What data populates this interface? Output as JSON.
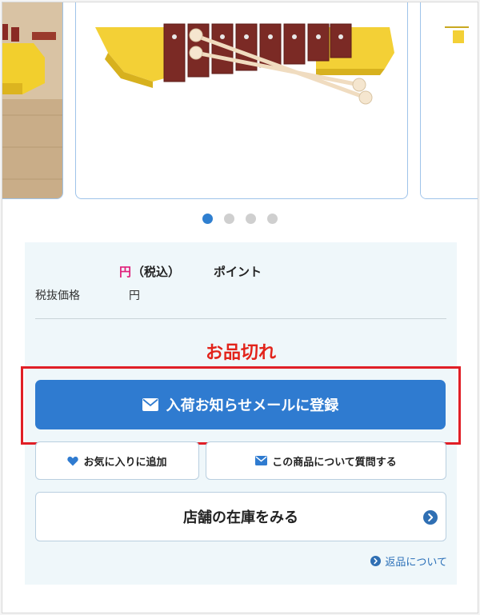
{
  "carousel": {
    "dots": [
      {
        "active": true
      },
      {
        "active": false
      },
      {
        "active": false
      },
      {
        "active": false
      }
    ]
  },
  "price": {
    "yen": "円",
    "tax_included": "（税込）",
    "points": "ポイント"
  },
  "net_price": {
    "label": "税抜価格",
    "yen": "円"
  },
  "status": {
    "sold_out": "お品切れ"
  },
  "buttons": {
    "notify": "入荷お知らせメールに登録",
    "favorite": "お気に入りに追加",
    "ask": "この商品について質問する",
    "store_stock": "店舗の在庫をみる"
  },
  "links": {
    "returns": "返品について"
  },
  "colors": {
    "accent": "#2f7bd0",
    "sold_out": "#e2231a",
    "price": "#e0207a",
    "highlight": "#e01f26",
    "panel_bg": "#eff7fa"
  },
  "icons": {
    "notify": "mail-icon",
    "favorite": "heart-icon",
    "ask": "mail-icon",
    "store": "chevron-right-circle-icon",
    "returns": "chevron-right-circle-icon"
  }
}
